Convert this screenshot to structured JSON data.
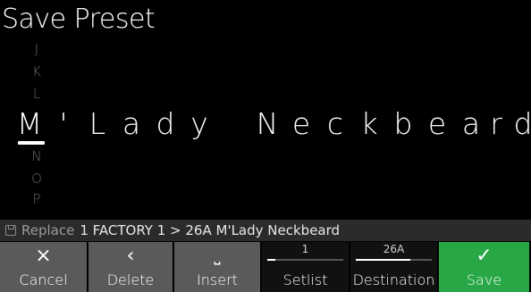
{
  "title": "Save Preset",
  "letters_above": [
    "J",
    "K",
    "L"
  ],
  "name_chars": [
    "M",
    "'",
    "L",
    "a",
    "d",
    "y",
    " ",
    "N",
    "e",
    "c",
    "k",
    "b",
    "e",
    "a",
    "r",
    "d"
  ],
  "letters_below": [
    "N",
    "O",
    "P"
  ],
  "status": {
    "icon": "floppy-disk-icon",
    "action": "Replace",
    "text": "1 FACTORY 1 > 26A M'Lady Neckbeard"
  },
  "buttons": {
    "cancel": {
      "label": "Cancel",
      "icon": "×"
    },
    "delete": {
      "label": "Delete",
      "icon": "‹"
    },
    "insert": {
      "label": "Insert",
      "icon": "⎵"
    },
    "setlist": {
      "label": "Setlist",
      "value": "1",
      "level": 0.1
    },
    "destination": {
      "label": "Destination",
      "value": "26A",
      "level": 0.72
    },
    "save": {
      "label": "Save",
      "icon": "✓"
    }
  },
  "colors": {
    "save_button": "#28a746",
    "soft_button": "#5a5a5a",
    "status_bar": "#2b2b2b"
  }
}
